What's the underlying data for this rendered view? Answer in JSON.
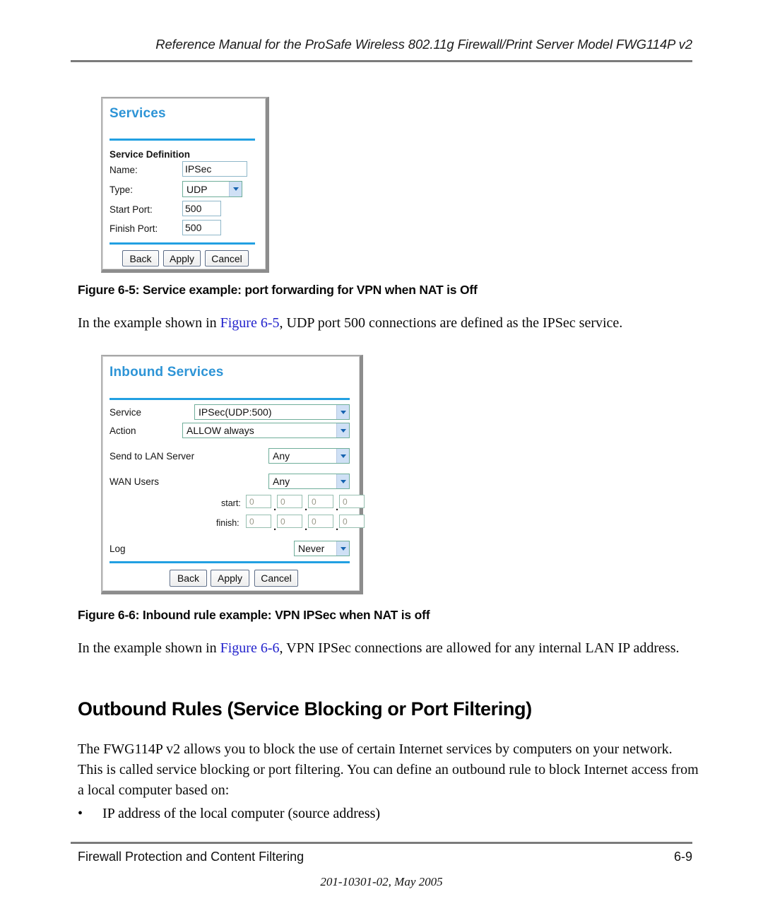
{
  "header": {
    "running_title": "Reference Manual for the ProSafe Wireless 802.11g  Firewall/Print Server Model FWG114P v2"
  },
  "theme": {
    "title_blue": "#2d94d6",
    "rule_blue": "#22a0e2",
    "xref_blue": "#2222cc",
    "rule_gray": "#7b7b7b"
  },
  "services_dialog": {
    "title": "Services",
    "section_label": "Service Definition",
    "fields": [
      {
        "label": "Name:",
        "value": "IPSec",
        "kind": "text"
      },
      {
        "label": "Type:",
        "value": "UDP",
        "kind": "select"
      },
      {
        "label": "Start Port:",
        "value": "500",
        "kind": "text"
      },
      {
        "label": "Finish Port:",
        "value": "500",
        "kind": "text"
      }
    ],
    "buttons": [
      {
        "label": "Back"
      },
      {
        "label": "Apply"
      },
      {
        "label": "Cancel"
      }
    ]
  },
  "figure_6_5": {
    "caption": "Figure 6-5:  Service example: port forwarding for VPN when NAT is Off",
    "paragraph_before": "In the example shown in ",
    "xref": "Figure 6-5",
    "paragraph_after": ", UDP port 500 connections are defined as the IPSec service."
  },
  "inbound_dialog": {
    "title": "Inbound Services",
    "rows": [
      {
        "label": "Service",
        "value": "IPSec(UDP:500)"
      },
      {
        "label": "Action",
        "value": "ALLOW always"
      },
      {
        "label": "Send to LAN Server",
        "value": "Any"
      },
      {
        "label": "WAN Users",
        "value": "Any"
      },
      {
        "label": "Log",
        "value": "Never"
      }
    ],
    "ip_ranges": [
      {
        "label": "start:",
        "octets": [
          "0",
          "0",
          "0",
          "0"
        ]
      },
      {
        "label": "finish:",
        "octets": [
          "0",
          "0",
          "0",
          "0"
        ]
      }
    ],
    "octet_separator": ".",
    "buttons": [
      {
        "label": "Back"
      },
      {
        "label": "Apply"
      },
      {
        "label": "Cancel"
      }
    ]
  },
  "figure_6_6": {
    "caption": "Figure 6-6:  Inbound rule example: VPN IPSec when NAT is off",
    "paragraph_before": "In the example shown in ",
    "xref": "Figure 6-6",
    "paragraph_after": ", VPN IPSec connections are allowed for any internal LAN IP address."
  },
  "outbound_section": {
    "heading": "Outbound Rules (Service Blocking or Port Filtering)",
    "paragraph": "The FWG114P v2 allows you to block the use of certain Internet services by computers on your network. This is called service blocking or port filtering. You can define an outbound rule to block Internet access from a local computer based on:",
    "bullet_glyph": "•",
    "bullets": [
      "IP address of the local computer (source address)"
    ]
  },
  "footer": {
    "left": "Firewall Protection and Content Filtering",
    "right": "6-9",
    "center": "201-10301-02, May 2005"
  }
}
